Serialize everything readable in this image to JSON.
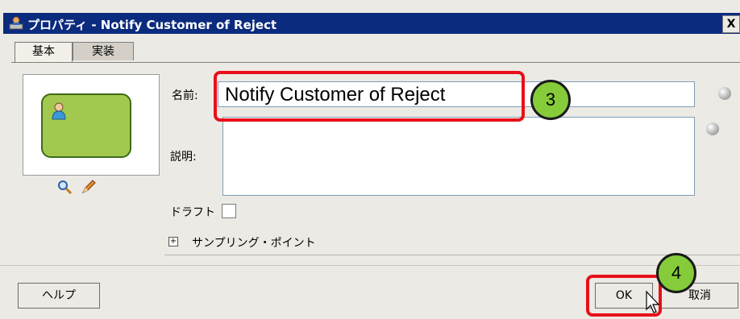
{
  "window": {
    "title": "プロパティ - Notify Customer of Reject",
    "close_label": "X"
  },
  "tabs": [
    {
      "label": "基本",
      "active": true
    },
    {
      "label": "実装",
      "active": false
    }
  ],
  "form": {
    "name_label": "名前:",
    "name_value": "Notify Customer of Reject",
    "description_label": "説明:",
    "description_value": "",
    "draft_label": "ドラフト",
    "draft_checked": false,
    "sampling_label": "サンプリング・ポイント",
    "expand_symbol": "⊞"
  },
  "footer": {
    "help_label": "ヘルプ",
    "ok_label": "OK",
    "cancel_label": "取消"
  },
  "callouts": [
    "3",
    "4"
  ],
  "colors": {
    "titlebar": "#0b2b7e",
    "highlight": "#e8101a",
    "callout_fill": "#86cc3a",
    "activity_fill": "#a3c84f"
  }
}
